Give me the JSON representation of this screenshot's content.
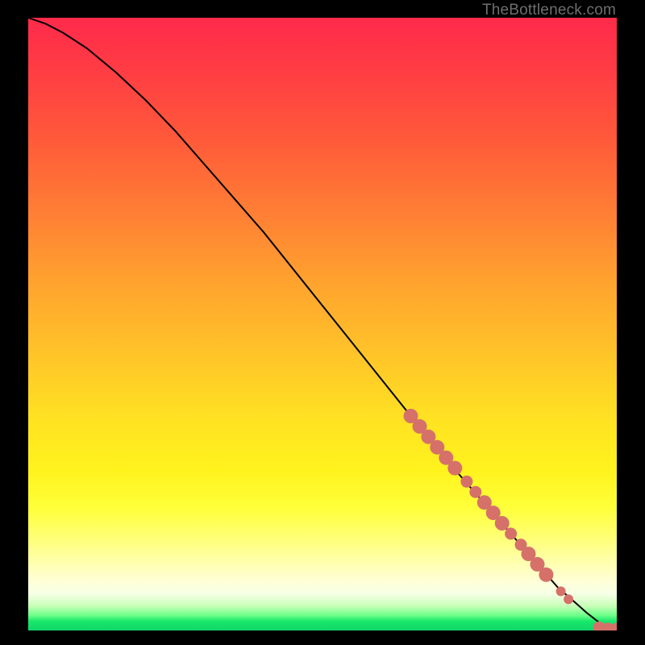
{
  "watermark": "TheBottleneck.com",
  "chart_data": {
    "type": "line",
    "title": "",
    "xlabel": "",
    "ylabel": "",
    "x_range": [
      0,
      100
    ],
    "y_range": [
      0,
      100
    ],
    "series": [
      {
        "name": "curve",
        "x": [
          0,
          3,
          6,
          10,
          15,
          20,
          25,
          30,
          35,
          40,
          45,
          50,
          55,
          60,
          65,
          70,
          75,
          80,
          85,
          90,
          93,
          95,
          97,
          98.5,
          100
        ],
        "y": [
          100,
          99,
          97.5,
          95,
          91,
          86.5,
          81.5,
          76,
          70.5,
          65,
          59,
          53,
          47,
          41,
          35,
          29,
          23.5,
          18,
          12.5,
          7,
          4.5,
          2.8,
          1.3,
          0.4,
          0.3
        ]
      }
    ],
    "scatter": {
      "name": "highlight-points",
      "color": "#d6716a",
      "points": [
        {
          "x": 65,
          "y": 35,
          "size": "big"
        },
        {
          "x": 66.5,
          "y": 33.3,
          "size": "big"
        },
        {
          "x": 68,
          "y": 31.6,
          "size": "big"
        },
        {
          "x": 69.5,
          "y": 29.9,
          "size": "big"
        },
        {
          "x": 71,
          "y": 28.2,
          "size": "big"
        },
        {
          "x": 72.5,
          "y": 26.5,
          "size": "big"
        },
        {
          "x": 74.5,
          "y": 24.3,
          "size": "med"
        },
        {
          "x": 76,
          "y": 22.6,
          "size": "med"
        },
        {
          "x": 77.5,
          "y": 20.9,
          "size": "big"
        },
        {
          "x": 79,
          "y": 19.2,
          "size": "big"
        },
        {
          "x": 80.5,
          "y": 17.5,
          "size": "big"
        },
        {
          "x": 82,
          "y": 15.8,
          "size": "med"
        },
        {
          "x": 83.7,
          "y": 14,
          "size": "med"
        },
        {
          "x": 85,
          "y": 12.5,
          "size": "big"
        },
        {
          "x": 86.5,
          "y": 10.8,
          "size": "big"
        },
        {
          "x": 88,
          "y": 9.1,
          "size": "big"
        },
        {
          "x": 90.5,
          "y": 6.4,
          "size": "small"
        },
        {
          "x": 91.8,
          "y": 5.1,
          "size": "small"
        },
        {
          "x": 97,
          "y": 0.5,
          "size": "med"
        },
        {
          "x": 98.5,
          "y": 0.3,
          "size": "med"
        },
        {
          "x": 100,
          "y": 0.3,
          "size": "med"
        }
      ]
    },
    "background_gradient": {
      "top": "#ff2a4b",
      "mid": "#ffe322",
      "bottom": "#11d66a"
    }
  }
}
